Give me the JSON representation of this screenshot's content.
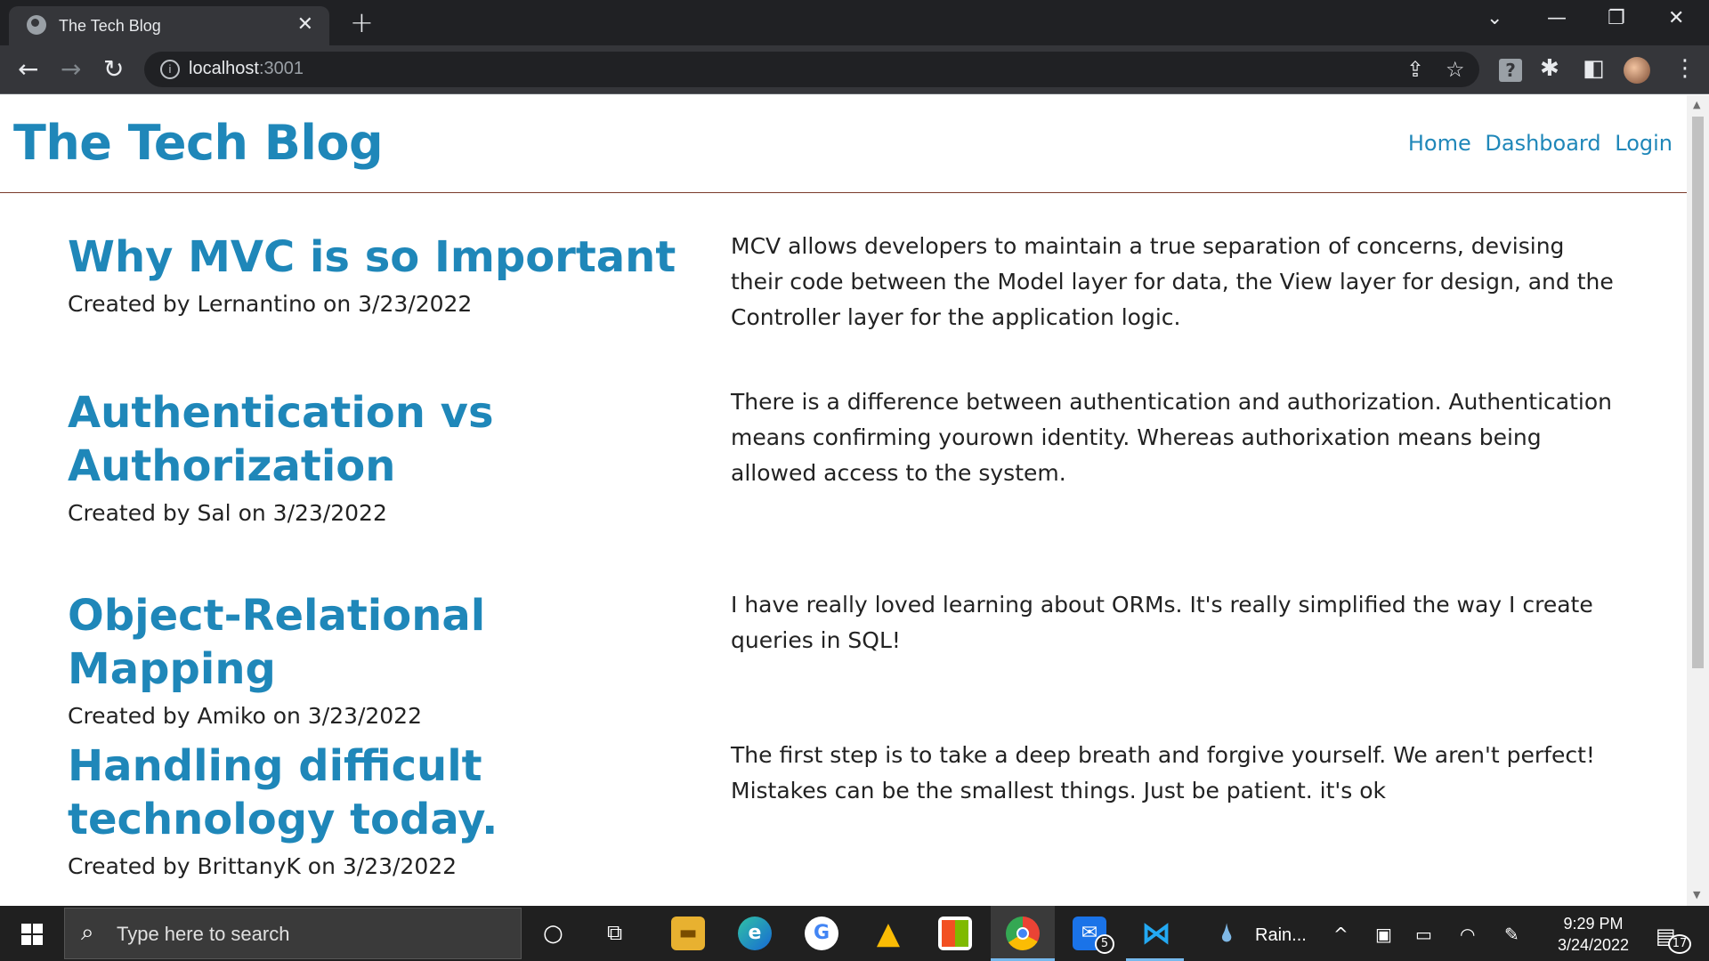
{
  "browser": {
    "tab_title": "The Tech Blog",
    "url_host": "localhost",
    "url_port": ":3001"
  },
  "site": {
    "title": "The Tech Blog",
    "nav": [
      "Home",
      "Dashboard",
      "Login"
    ]
  },
  "posts": [
    {
      "title": "Why MVC is so Important",
      "meta": "Created by Lernantino on 3/23/2022",
      "body": "MCV allows developers to maintain a true separation of concerns, devising their code between the Model layer for data, the View layer for design, and the Controller layer for the application logic."
    },
    {
      "title": "Authentication vs Authorization",
      "meta": "Created by Sal on 3/23/2022",
      "body": "There is a difference between authentication and authorization. Authentication means confirming yourown identity. Whereas authorixation means being allowed access to the system."
    },
    {
      "title": "Object-Relational Mapping",
      "meta": "Created by Amiko on 3/23/2022",
      "body": "I have really loved learning about ORMs. It's really simplified the way I create queries in SQL!"
    },
    {
      "title": "Handling difficult technology today.",
      "meta": "Created by BrittanyK on 3/23/2022",
      "body": "The first step is to take a deep breath and forgive yourself. We aren't perfect! Mistakes can be the smallest things. Just be patient. it's ok"
    }
  ],
  "taskbar": {
    "search_placeholder": "Type here to search",
    "weather": "Rain...",
    "time": "9:29 PM",
    "date": "3/24/2022",
    "mail_badge": "5",
    "notif_badge": "17"
  },
  "colors": {
    "accent": "#1f87b9",
    "chrome_dark": "#202124",
    "chrome_toolbar": "#35363a",
    "taskbar": "#202020"
  }
}
